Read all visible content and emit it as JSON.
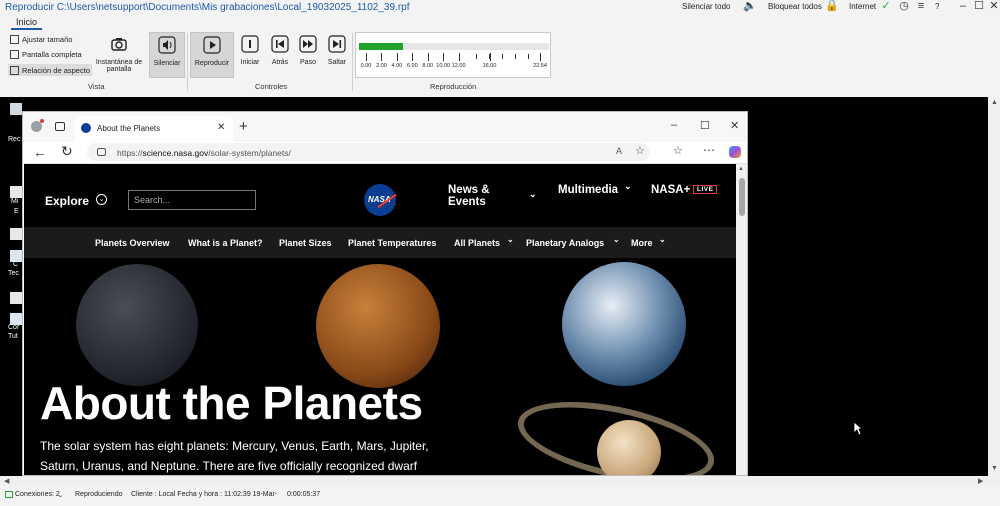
{
  "window": {
    "title": "Reproducir C:\\Users\\netsupport\\Documents\\Mis grabaciones\\Local_19032025_1102_39.rpf",
    "mute_all": "Silenciar todo",
    "lock_all": "Bloquear todos",
    "internet": "Internet",
    "help": "?"
  },
  "ribbon": {
    "tab": "Inicio",
    "view": {
      "fit_size": "Ajustar tamaño",
      "full_screen": "Pantalla completa",
      "aspect_ratio": "Relación de aspecto",
      "snapshot_line1": "Instantánea de",
      "snapshot_line2": "pantalla",
      "mute": "Silenciar",
      "group_label": "Vista"
    },
    "controls": {
      "play": "Reproducir",
      "start": "Iniciar",
      "back": "Atrás",
      "step": "Paso",
      "skip": "Saltar",
      "group_label": "Controles"
    },
    "playback": {
      "group_label": "Reproducción",
      "progress_fraction": 0.23,
      "tick_labels": [
        "0.00",
        "2.00",
        "4.00",
        "6.00",
        "8.00",
        "10.00",
        "12.00",
        "16.00",
        "22.54"
      ]
    }
  },
  "desktop": {
    "labels": [
      "Rec",
      "Mi",
      "E",
      "C",
      "Tec",
      "Cor",
      "Tut"
    ]
  },
  "browser": {
    "tab_title": "About the Planets",
    "url_prefix": "https://",
    "url_host": "science.nasa.gov",
    "url_path": "/solar-system/planets/",
    "read_aloud": "A",
    "page": {
      "explore": "Explore",
      "search_placeholder": "Search...",
      "logo_text": "NASA",
      "news_events_1": "News &",
      "news_events_2": "Events",
      "multimedia": "Multimedia",
      "nasa_plus": "NASA+",
      "live": "LIVE",
      "subnav": [
        "Planets Overview",
        "What is a Planet?",
        "Planet Sizes",
        "Planet Temperatures",
        "All Planets",
        "Planetary Analogs",
        "More"
      ],
      "hero_title": "About the Planets",
      "hero_line1": "The solar system has eight planets: Mercury, Venus, Earth, Mars, Jupiter,",
      "hero_line2": "Saturn, Uranus, and Neptune. There are five officially recognized dwarf"
    }
  },
  "status": {
    "connections": "Conexiones: 2",
    "playing": "Reproduciendo",
    "client": "Cliente : Local Fecha y hora : 11:02:39  19-Mar-",
    "elapsed": "0:00:05:37"
  },
  "colors": {
    "accent": "#1e5aa8",
    "progress": "#1fa32a",
    "live_badge": "#e03c31"
  }
}
